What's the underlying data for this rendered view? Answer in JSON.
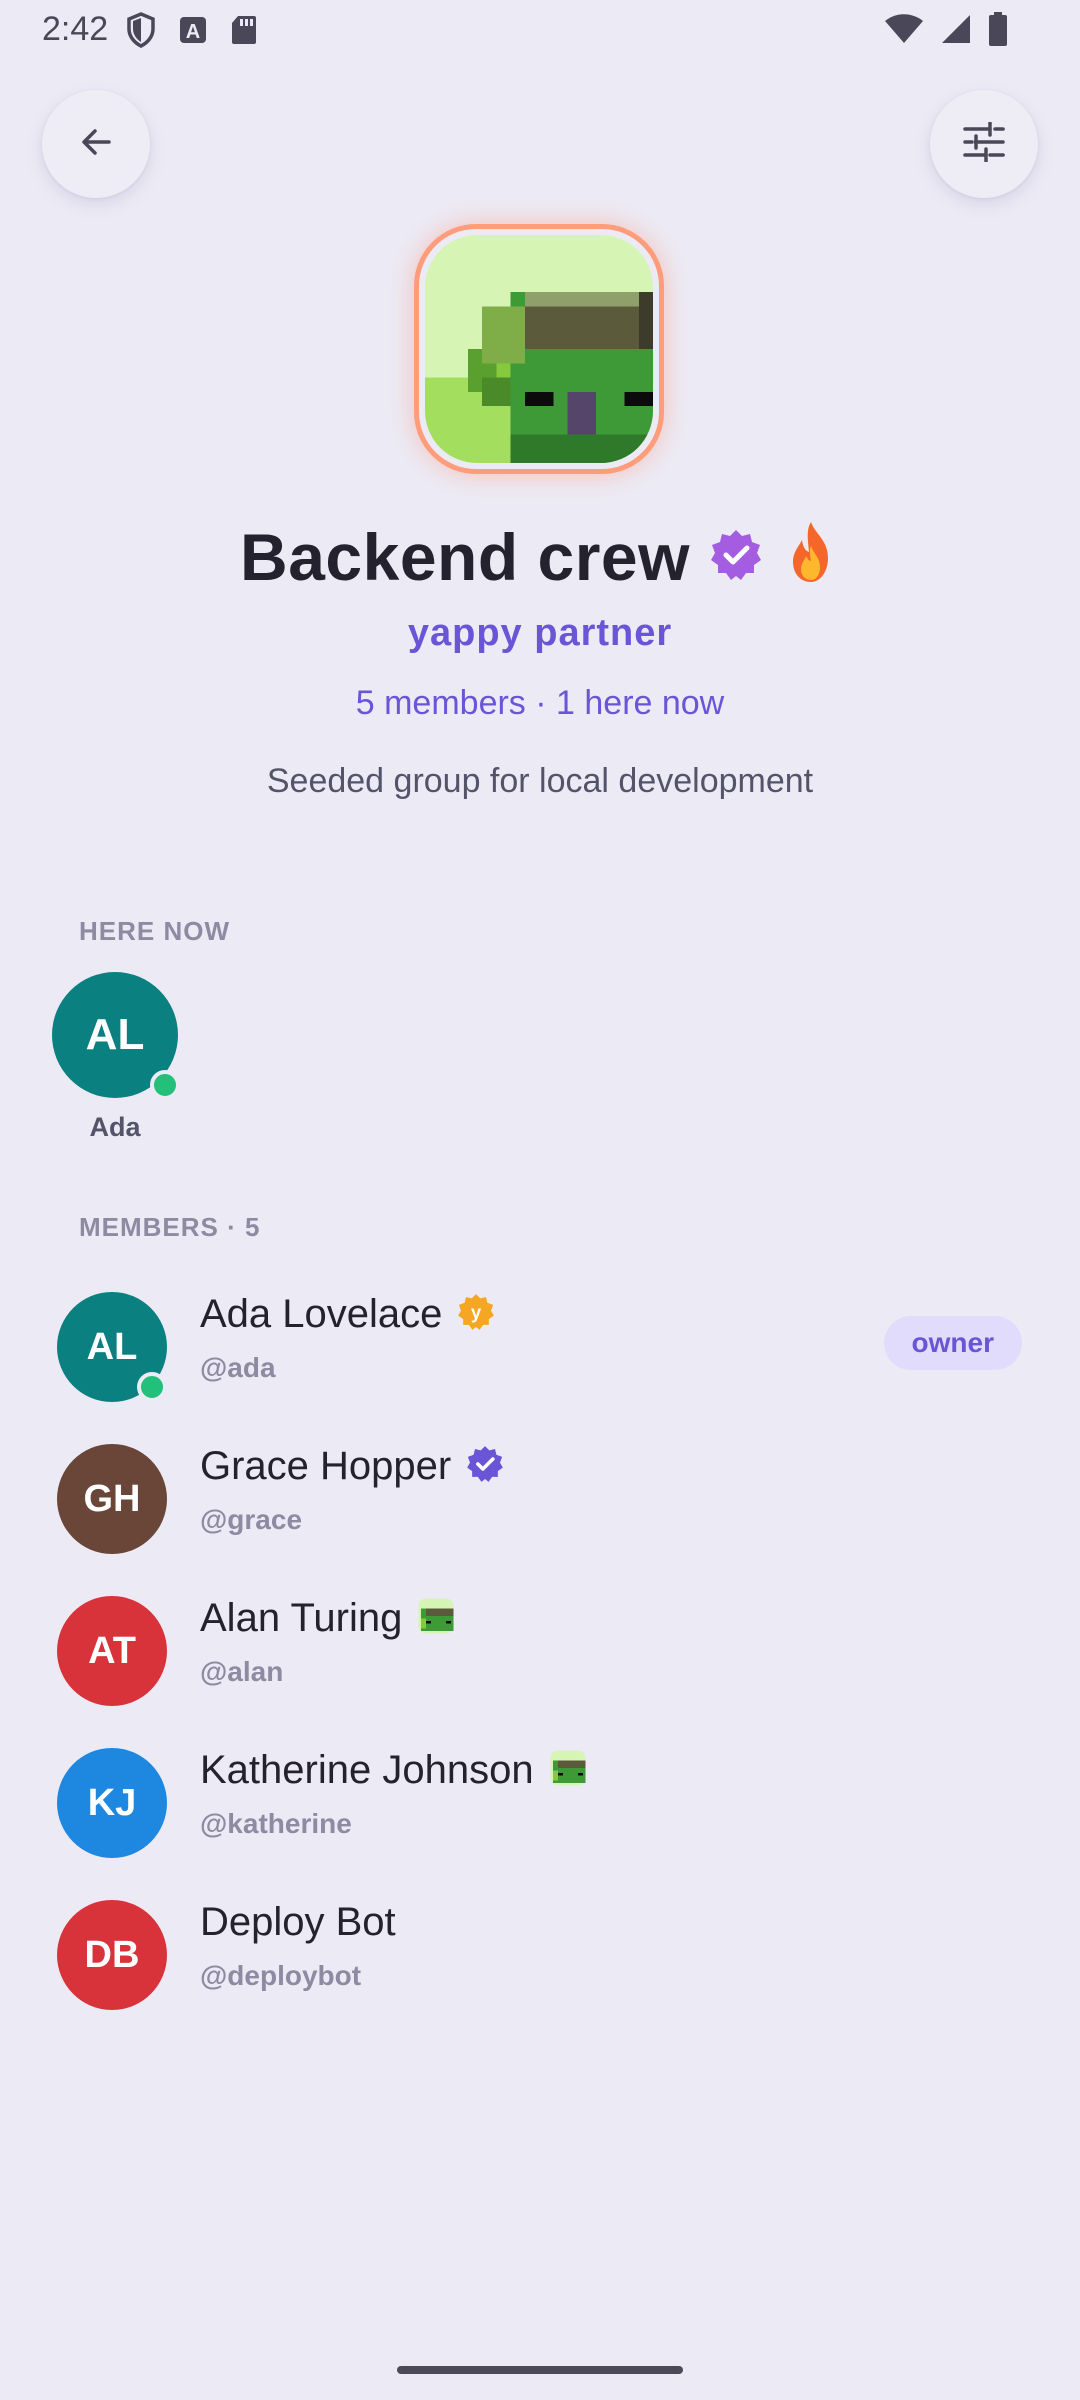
{
  "status_bar": {
    "time": "2:42"
  },
  "group": {
    "name": "Backend crew",
    "partner_label": "yappy partner",
    "member_count": "5 members · 1 here now",
    "description": "Seeded group for local development"
  },
  "here_now": {
    "title": "HERE NOW",
    "users": [
      {
        "initials": "AL",
        "name": "Ada",
        "color": "#0b8080",
        "online": true
      }
    ]
  },
  "members": {
    "title": "MEMBERS · 5",
    "list": [
      {
        "initials": "AL",
        "name": "Ada Lovelace",
        "handle": "@ada",
        "color": "#0b8080",
        "badge": "yappy-y-icon",
        "role": "owner",
        "online": true
      },
      {
        "initials": "GH",
        "name": "Grace Hopper",
        "handle": "@grace",
        "color": "#6a4638",
        "badge": "verified-check-icon"
      },
      {
        "initials": "AT",
        "name": "Alan Turing",
        "handle": "@alan",
        "color": "#d8333a",
        "badge": "pixel-frog-icon"
      },
      {
        "initials": "KJ",
        "name": "Katherine Johnson",
        "handle": "@katherine",
        "color": "#1e88e0",
        "badge": "pixel-frog-icon"
      },
      {
        "initials": "DB",
        "name": "Deploy Bot",
        "handle": "@deploybot",
        "color": "#d8333a"
      }
    ]
  },
  "colors": {
    "background": "#ecebf5",
    "accent": "#6a55d6",
    "online": "#22c07a",
    "avatar_ring": "#ff9c7a"
  }
}
